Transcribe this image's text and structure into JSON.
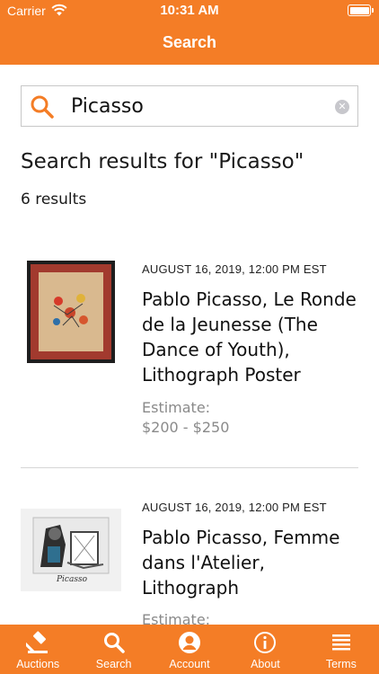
{
  "status_bar": {
    "carrier": "Carrier",
    "time": "10:31 AM",
    "battery_level": 1.0
  },
  "nav": {
    "title": "Search"
  },
  "search": {
    "value": "Picasso"
  },
  "results_header": {
    "title": "Search results for \"Picasso\"",
    "count": "6 results"
  },
  "results": [
    {
      "date": "AUGUST 16, 2019, 12:00 PM EST",
      "title": "Pablo Picasso, Le Ronde de la Jeunesse (The Dance of Youth), Lithograph Poster",
      "estimate_label": "Estimate:",
      "estimate_value": "$200 - $250"
    },
    {
      "date": "AUGUST 16, 2019, 12:00 PM EST",
      "title": "Pablo Picasso, Femme dans l'Atelier, Lithograph",
      "estimate_label": "Estimate:",
      "estimate_value": "",
      "thumb_signature": "Picasso"
    }
  ],
  "tabs": [
    {
      "label": "Auctions",
      "icon": "gavel-icon",
      "active": false
    },
    {
      "label": "Search",
      "icon": "search-icon",
      "active": true
    },
    {
      "label": "Account",
      "icon": "account-icon",
      "active": false
    },
    {
      "label": "About",
      "icon": "info-icon",
      "active": false
    },
    {
      "label": "Terms",
      "icon": "list-icon",
      "active": false
    }
  ],
  "colors": {
    "accent": "#f47d26",
    "muted_text": "#8a8a8a"
  }
}
